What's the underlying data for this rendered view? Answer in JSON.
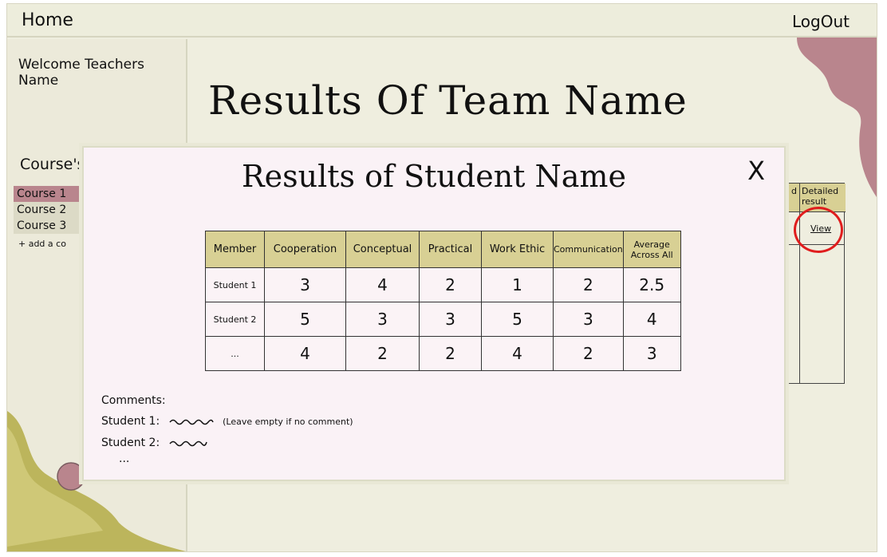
{
  "topbar": {
    "home_label": "Home",
    "logout_label": "LogOut"
  },
  "sidebar": {
    "welcome": "Welcome Teachers Name",
    "courses_title": "Course's",
    "courses": [
      "Course 1",
      "Course 2",
      "Course 3"
    ],
    "add_course": "+ add a co"
  },
  "main": {
    "title": "Results Of Team Name",
    "team_table": {
      "col_a_header": "ho d",
      "col_b_header": "Detailed result",
      "view_label": "View"
    }
  },
  "modal": {
    "title": "Results of Student Name",
    "close_label": "X",
    "table": {
      "headers": [
        "Member",
        "Cooperation",
        "Conceptual",
        "Practical",
        "Work Ethic",
        "Communication",
        "Average Across All"
      ],
      "rows": [
        [
          "Student 1",
          "3",
          "4",
          "2",
          "1",
          "2",
          "2.5"
        ],
        [
          "Student 2",
          "5",
          "3",
          "3",
          "5",
          "3",
          "4"
        ],
        [
          "...",
          "4",
          "2",
          "2",
          "4",
          "2",
          "3"
        ]
      ]
    },
    "comments": {
      "title": "Comments:",
      "line1_label": "Student 1:",
      "line1_hint": "(Leave empty if no comment)",
      "line2_label": "Student 2:",
      "ellipsis": "..."
    }
  },
  "colors": {
    "header_fill": "#d8d094",
    "active_course": "#b9858d",
    "highlight": "#e01d1d",
    "modal_bg": "#faf2f6"
  }
}
